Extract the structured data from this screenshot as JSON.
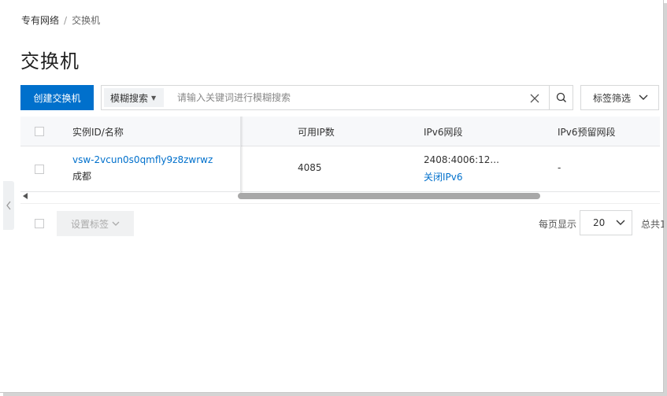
{
  "breadcrumb": {
    "parent": "专有网络",
    "separator": "/",
    "current": "交换机"
  },
  "page": {
    "title": "交换机"
  },
  "toolbar": {
    "create_label": "创建交换机",
    "search_type": "模糊搜索",
    "search_placeholder": "请输入关键词进行模糊搜索",
    "tag_filter_label": "标签筛选"
  },
  "table": {
    "headers": {
      "instance": "实例ID/名称",
      "available_ip": "可用IP数",
      "ipv6_cidr": "IPv6网段",
      "ipv6_reserved": "IPv6预留网段"
    },
    "rows": [
      {
        "id": "vsw-2vcun0s0qmfly9z8zwrwz",
        "name": "成都",
        "available_ip": "4085",
        "ipv6_cidr": "2408:4006:12...",
        "ipv6_action": "关闭IPv6",
        "ipv6_reserved": "-"
      }
    ]
  },
  "footer": {
    "set_tag_label": "设置标签",
    "per_page_label": "每页显示",
    "page_size": "20",
    "total_label": "总共1"
  },
  "colors": {
    "primary": "#0070cc",
    "header_bg": "#f7f8fa",
    "border": "#d7d8d9"
  },
  "icons": [
    "chevron-left-icon",
    "close-icon",
    "search-icon",
    "chevron-down-icon",
    "scroll-left-arrow-icon"
  ]
}
